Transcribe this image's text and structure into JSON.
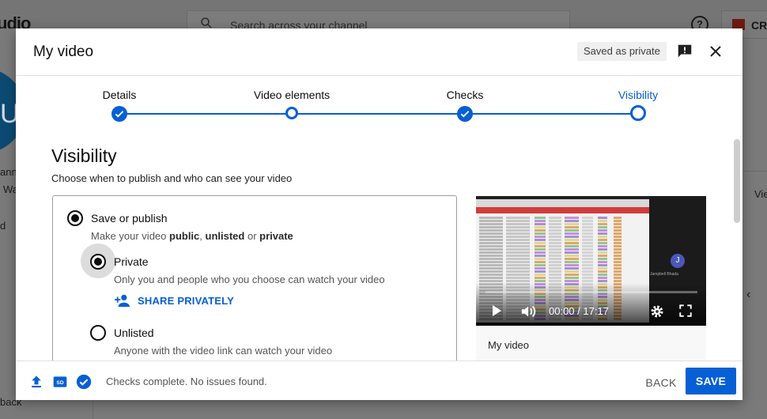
{
  "background": {
    "logo_text": "udio",
    "search_placeholder": "Search across your channel",
    "help_glyph": "?",
    "create_label": "CR",
    "avatar_letter": "U",
    "sidebar_text_1": "ann",
    "sidebar_text_2": "Wa",
    "sidebar_text_3": "d",
    "right_text": "Vie",
    "bottom_text": "back"
  },
  "dialog": {
    "title": "My video",
    "saved_status": "Saved as private",
    "icons": {
      "feedback": "feedback-icon",
      "close": "close-icon"
    }
  },
  "stepper": {
    "steps": [
      {
        "label": "Details",
        "state": "done"
      },
      {
        "label": "Video elements",
        "state": "visited"
      },
      {
        "label": "Checks",
        "state": "done"
      },
      {
        "label": "Visibility",
        "state": "current"
      }
    ]
  },
  "visibility": {
    "heading": "Visibility",
    "subheading": "Choose when to publish and who can see your video",
    "save_or_publish": {
      "label": "Save or publish",
      "desc_prefix": "Make your video ",
      "desc_public": "public",
      "desc_sep1": ", ",
      "desc_unlisted": "unlisted",
      "desc_sep2": " or ",
      "desc_private": "private",
      "selected": true
    },
    "options": [
      {
        "label": "Private",
        "desc": "Only you and people who you choose can watch your video",
        "selected": true
      },
      {
        "label": "Unlisted",
        "desc": "Anyone with the video link can watch your video",
        "selected": false
      }
    ],
    "share_privately_label": "SHARE PRIVATELY"
  },
  "video_preview": {
    "time": "00:00 / 17:17",
    "title": "My video",
    "avatar_letter": "J",
    "caption": "Jampbell Bhada"
  },
  "footer": {
    "status": "Checks complete. No issues found.",
    "back_label": "BACK",
    "save_label": "SAVE",
    "icons": [
      "upload-icon",
      "subtitles-icon",
      "check-circle-icon"
    ]
  },
  "colors": {
    "accent": "#065fd4",
    "text": "#0d0d0d",
    "muted": "#555555"
  }
}
